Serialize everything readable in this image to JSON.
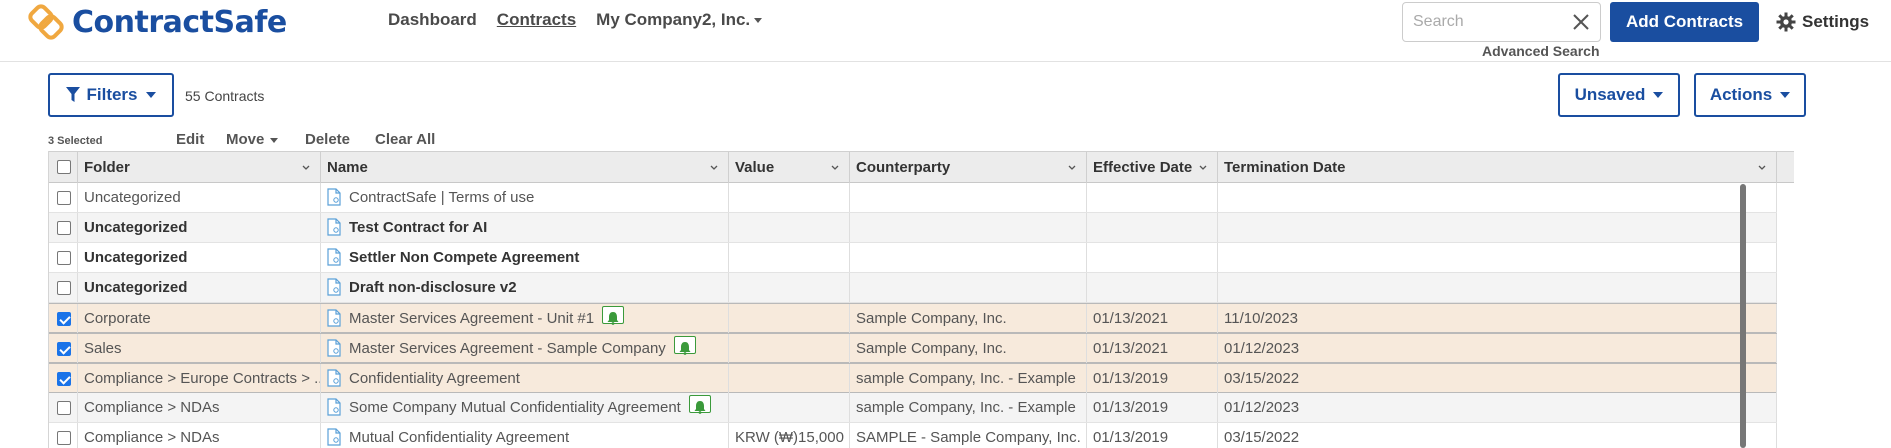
{
  "brand": {
    "name": "ContractSafe",
    "accent": "#1a4ea0",
    "logo_color": "#f0a840"
  },
  "nav": {
    "items": [
      {
        "label": "Dashboard"
      },
      {
        "label": "Contracts"
      },
      {
        "label": "My Company2, Inc."
      }
    ]
  },
  "search": {
    "placeholder": "Search",
    "value": "",
    "advanced_label": "Advanced Search"
  },
  "header": {
    "add_label": "Add Contracts",
    "settings_label": "Settings"
  },
  "toolbar": {
    "filters_label": "Filters",
    "count_label": "55 Contracts",
    "unsaved_label": "Unsaved",
    "actions_label": "Actions"
  },
  "selection": {
    "selected_label": "3 Selected",
    "edit_label": "Edit",
    "move_label": "Move",
    "delete_label": "Delete",
    "clear_label": "Clear All"
  },
  "table": {
    "columns": [
      "Folder",
      "Name",
      "Value",
      "Counterparty",
      "Effective Date",
      "Termination Date"
    ],
    "rows": [
      {
        "checked": false,
        "bold": false,
        "folder": "Uncategorized",
        "name": "ContractSafe | Terms of use",
        "value": "",
        "counterparty": "",
        "effective": "",
        "termination": "",
        "bell": false
      },
      {
        "checked": false,
        "bold": true,
        "folder": "Uncategorized",
        "name": "Test Contract for AI",
        "value": "",
        "counterparty": "",
        "effective": "",
        "termination": "",
        "bell": false
      },
      {
        "checked": false,
        "bold": true,
        "folder": "Uncategorized",
        "name": "Settler Non Compete Agreement",
        "value": "",
        "counterparty": "",
        "effective": "",
        "termination": "",
        "bell": false
      },
      {
        "checked": false,
        "bold": true,
        "folder": "Uncategorized",
        "name": "Draft non-disclosure v2",
        "value": "",
        "counterparty": "",
        "effective": "",
        "termination": "",
        "bell": false
      },
      {
        "checked": true,
        "bold": false,
        "folder": "Corporate",
        "name": "Master Services Agreement - Unit #1",
        "value": "",
        "counterparty": "Sample Company, Inc.",
        "effective": "01/13/2021",
        "termination": "11/10/2023",
        "bell": true
      },
      {
        "checked": true,
        "bold": false,
        "folder": "Sales",
        "name": "Master Services Agreement - Sample Company",
        "value": "",
        "counterparty": "Sample Company, Inc.",
        "effective": "01/13/2021",
        "termination": "01/12/2023",
        "bell": true
      },
      {
        "checked": true,
        "bold": false,
        "folder": "Compliance > Europe Contracts > ...",
        "name": "Confidentiality Agreement",
        "value": "",
        "counterparty": "sample Company, Inc. - Example",
        "effective": "01/13/2019",
        "termination": "03/15/2022",
        "bell": false
      },
      {
        "checked": false,
        "bold": false,
        "folder": "Compliance > NDAs",
        "name": "Some Company Mutual Confidentiality Agreement",
        "value": "",
        "counterparty": "sample Company, Inc. - Example",
        "effective": "01/13/2019",
        "termination": "01/12/2023",
        "bell": true
      },
      {
        "checked": false,
        "bold": false,
        "folder": "Compliance > NDAs",
        "name": "Mutual Confidentiality Agreement",
        "value": "KRW (₩)15,000",
        "counterparty": "SAMPLE - Sample Company, Inc.",
        "effective": "01/13/2019",
        "termination": "03/15/2022",
        "bell": false
      }
    ]
  }
}
